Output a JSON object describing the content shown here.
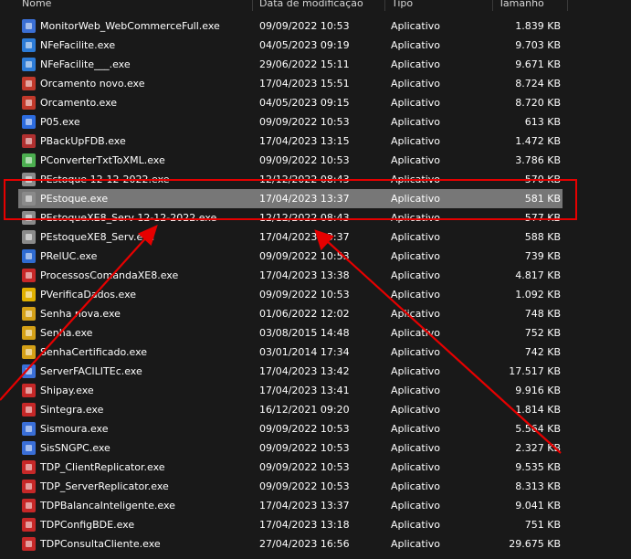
{
  "columns": {
    "name": "Nome",
    "date": "Data de modificação",
    "type": "Tipo",
    "size": "Tamanho"
  },
  "files": [
    {
      "name": "MonitorWeb_WebCommerceFull.exe",
      "date": "09/09/2022 10:53",
      "type": "Aplicativo",
      "size": "1.839 KB",
      "icon_color": "#3b6fd4"
    },
    {
      "name": "NFeFacilite.exe",
      "date": "04/05/2023 09:19",
      "type": "Aplicativo",
      "size": "9.703 KB",
      "icon_color": "#2c7bd6"
    },
    {
      "name": "NFeFacilite___.exe",
      "date": "29/06/2022 15:11",
      "type": "Aplicativo",
      "size": "9.671 KB",
      "icon_color": "#2c7bd6"
    },
    {
      "name": "Orcamento novo.exe",
      "date": "17/04/2023 15:51",
      "type": "Aplicativo",
      "size": "8.724 KB",
      "icon_color": "#c0392b"
    },
    {
      "name": "Orcamento.exe",
      "date": "04/05/2023 09:15",
      "type": "Aplicativo",
      "size": "8.720 KB",
      "icon_color": "#c0392b"
    },
    {
      "name": "P05.exe",
      "date": "09/09/2022 10:53",
      "type": "Aplicativo",
      "size": "613 KB",
      "icon_color": "#2d6cdf"
    },
    {
      "name": "PBackUpFDB.exe",
      "date": "17/04/2023 13:15",
      "type": "Aplicativo",
      "size": "1.472 KB",
      "icon_color": "#b03030"
    },
    {
      "name": "PConverterTxtToXML.exe",
      "date": "09/09/2022 10:53",
      "type": "Aplicativo",
      "size": "3.786 KB",
      "icon_color": "#4caf50"
    },
    {
      "name": "PEstoque 12-12-2022.exe",
      "date": "12/12/2022 08:43",
      "type": "Aplicativo",
      "size": "570 KB",
      "icon_color": "#8a8a8a"
    },
    {
      "name": "PEstoque.exe",
      "date": "17/04/2023 13:37",
      "type": "Aplicativo",
      "size": "581 KB",
      "icon_color": "#8a8a8a",
      "selected": true
    },
    {
      "name": "PEstoqueXE8_Serv 12-12-2022.exe",
      "date": "12/12/2022 08:43",
      "type": "Aplicativo",
      "size": "577 KB",
      "icon_color": "#8a8a8a"
    },
    {
      "name": "PEstoqueXE8_Serv.exe",
      "date": "17/04/2023 13:37",
      "type": "Aplicativo",
      "size": "588 KB",
      "icon_color": "#8a8a8a"
    },
    {
      "name": "PRelUC.exe",
      "date": "09/09/2022 10:53",
      "type": "Aplicativo",
      "size": "739 KB",
      "icon_color": "#2f6bd1"
    },
    {
      "name": "ProcessosComandaXE8.exe",
      "date": "17/04/2023 13:38",
      "type": "Aplicativo",
      "size": "4.817 KB",
      "icon_color": "#c62828"
    },
    {
      "name": "PVerificaDados.exe",
      "date": "09/09/2022 10:53",
      "type": "Aplicativo",
      "size": "1.092 KB",
      "icon_color": "#e0b000"
    },
    {
      "name": "Senha nova.exe",
      "date": "01/06/2022 12:02",
      "type": "Aplicativo",
      "size": "748 KB",
      "icon_color": "#d4a017"
    },
    {
      "name": "Senha.exe",
      "date": "03/08/2015 14:48",
      "type": "Aplicativo",
      "size": "752 KB",
      "icon_color": "#d4a017"
    },
    {
      "name": "SenhaCertificado.exe",
      "date": "03/01/2014 17:34",
      "type": "Aplicativo",
      "size": "742 KB",
      "icon_color": "#d4a017"
    },
    {
      "name": "ServerFACILITEc.exe",
      "date": "17/04/2023 13:42",
      "type": "Aplicativo",
      "size": "17.517 KB",
      "icon_color": "#3a6fd8"
    },
    {
      "name": "Shipay.exe",
      "date": "17/04/2023 13:41",
      "type": "Aplicativo",
      "size": "9.916 KB",
      "icon_color": "#c62828"
    },
    {
      "name": "Sintegra.exe",
      "date": "16/12/2021 09:20",
      "type": "Aplicativo",
      "size": "1.814 KB",
      "icon_color": "#c62828"
    },
    {
      "name": "Sismoura.exe",
      "date": "09/09/2022 10:53",
      "type": "Aplicativo",
      "size": "5.564 KB",
      "icon_color": "#3a6fd8"
    },
    {
      "name": "SisSNGPC.exe",
      "date": "09/09/2022 10:53",
      "type": "Aplicativo",
      "size": "2.327 KB",
      "icon_color": "#3a6fd8"
    },
    {
      "name": "TDP_ClientReplicator.exe",
      "date": "09/09/2022 10:53",
      "type": "Aplicativo",
      "size": "9.535 KB",
      "icon_color": "#c62828"
    },
    {
      "name": "TDP_ServerReplicator.exe",
      "date": "09/09/2022 10:53",
      "type": "Aplicativo",
      "size": "8.313 KB",
      "icon_color": "#c62828"
    },
    {
      "name": "TDPBalancaInteligente.exe",
      "date": "17/04/2023 13:37",
      "type": "Aplicativo",
      "size": "9.041 KB",
      "icon_color": "#c62828"
    },
    {
      "name": "TDPConfigBDE.exe",
      "date": "17/04/2023 13:18",
      "type": "Aplicativo",
      "size": "751 KB",
      "icon_color": "#c62828"
    },
    {
      "name": "TDPConsultaCliente.exe",
      "date": "27/04/2023 16:56",
      "type": "Aplicativo",
      "size": "29.675 KB",
      "icon_color": "#c62828"
    }
  ],
  "annotation_color": "#e60000"
}
